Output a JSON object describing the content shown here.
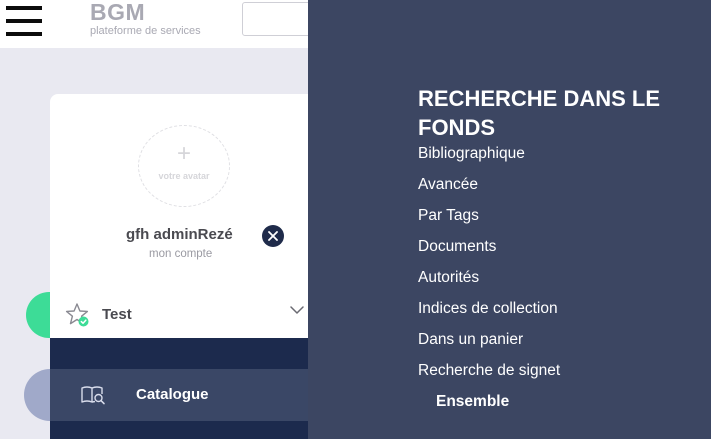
{
  "header": {
    "logo_title": "BGM",
    "logo_subtitle": "plateforme de services",
    "menu_icon": "hamburger-icon"
  },
  "profile": {
    "avatar_text": "votre avatar",
    "avatar_plus": "+",
    "user_name": "gfh adminRezé",
    "account_link": "mon compte",
    "logout_icon": "close-icon"
  },
  "sidebar": {
    "test_label": "Test",
    "test_icon": "star-check-icon",
    "catalogue_label": "Catalogue",
    "catalogue_icon": "book-search-icon"
  },
  "menu": {
    "heading": "RECHERCHE DANS LE FONDS",
    "items": [
      "Bibliographique",
      "Avancée",
      "Par Tags",
      "Documents",
      "Autorités",
      "Indices de collection",
      "Dans un panier",
      "Recherche de signet"
    ],
    "sub_item": "Ensemble"
  },
  "colors": {
    "menu_panel": "#3c4662",
    "nav_dark": "#1c2a4d",
    "accent_green": "#3ddc97",
    "page_bg": "#e9e9f1"
  }
}
